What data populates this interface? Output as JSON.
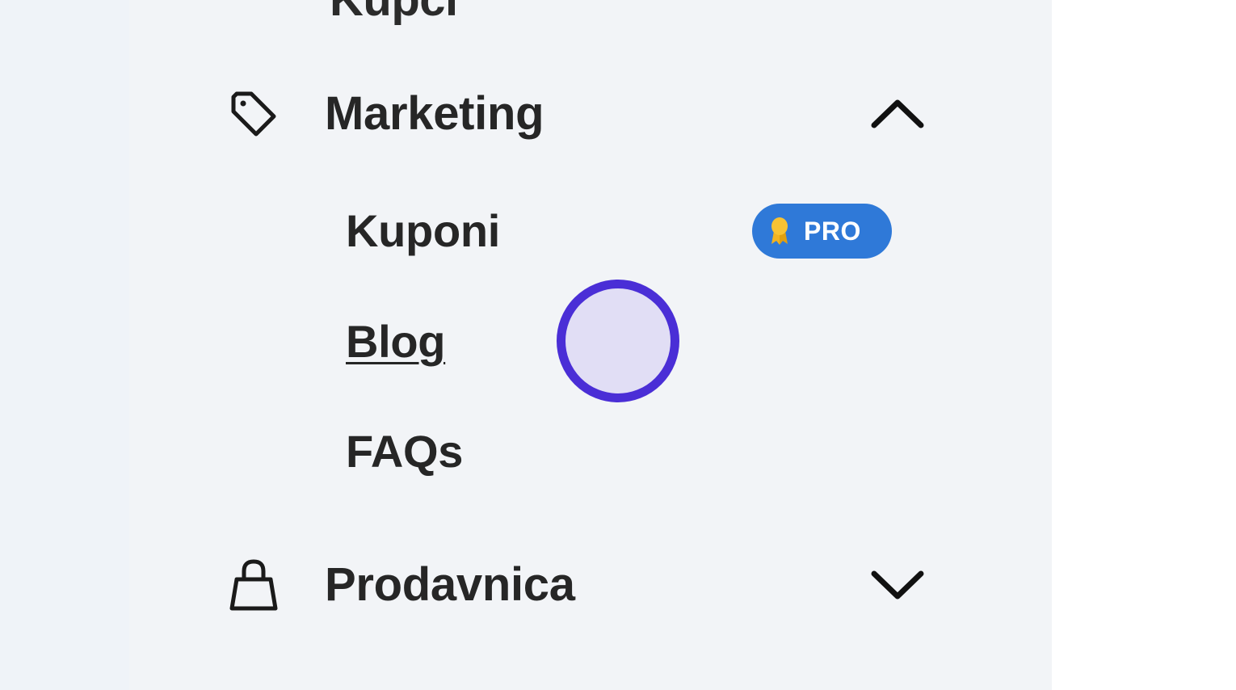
{
  "sidebar": {
    "top_cut_label": "Kupci",
    "sections": [
      {
        "label": "Marketing",
        "icon": "tag-icon",
        "expanded": true,
        "chevron": "chevron-up-icon",
        "items": [
          {
            "label": "Kuponi",
            "badge": {
              "label": "PRO",
              "icon": "medal-icon",
              "color": "#2f79d8"
            }
          },
          {
            "label": "Blog",
            "hovered": true
          },
          {
            "label": "FAQs"
          }
        ]
      },
      {
        "label": "Prodavnica",
        "icon": "shopping-bag-icon",
        "expanded": false,
        "chevron": "chevron-down-icon"
      }
    ]
  },
  "cursor": {
    "color": "#4a2ed6",
    "fill": "#e1def5"
  }
}
